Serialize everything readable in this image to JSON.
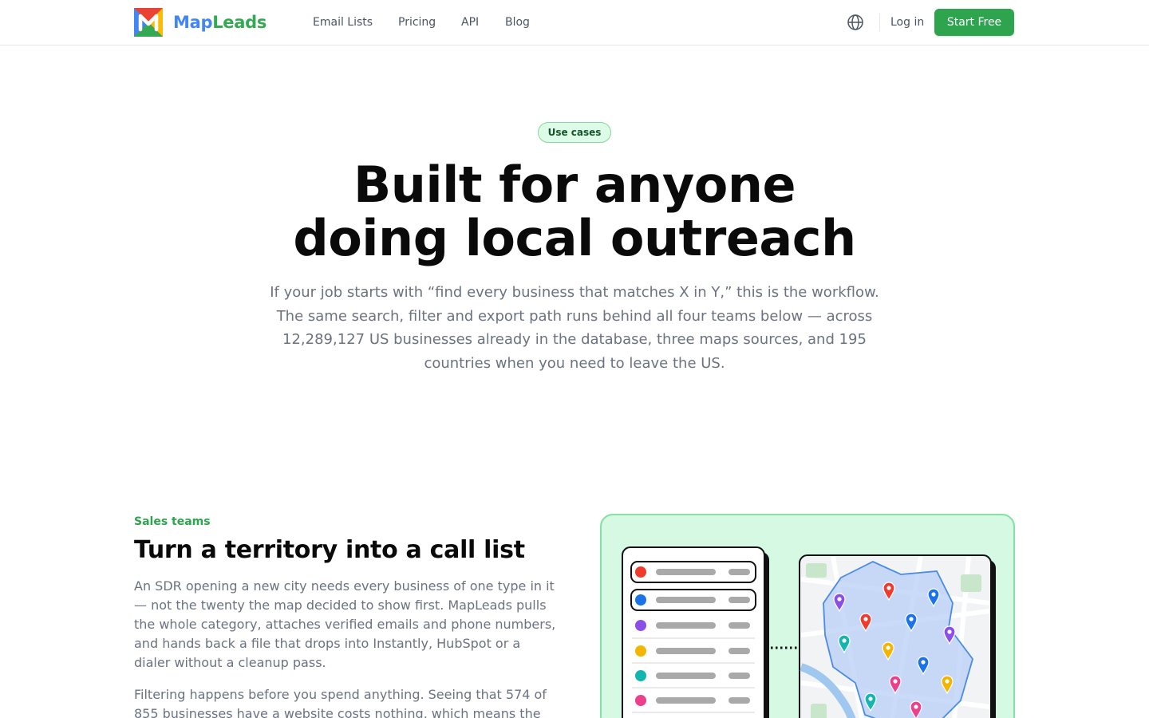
{
  "header": {
    "brand_part1": "Map",
    "brand_part2": "Leads",
    "nav": [
      {
        "label": "Email Lists"
      },
      {
        "label": "Pricing"
      },
      {
        "label": "API"
      },
      {
        "label": "Blog"
      }
    ],
    "language_icon": "globe-icon",
    "login_label": "Log in",
    "cta_label": "Start Free"
  },
  "hero": {
    "badge": "Use cases",
    "title_line1": "Built for anyone",
    "title_line2": "doing local outreach",
    "subtitle_lines": [
      "If your job starts with “find every business that matches X in Y,” this is the workflow.",
      "The same search, filter and export path runs behind all four teams below — across",
      "12,289,127 US businesses already in the database, three maps sources, and 195",
      "countries when you need to leave the US."
    ]
  },
  "section": {
    "label": "Sales teams",
    "title": "Turn a territory into a call list",
    "paragraph1": "An SDR opening a new city needs every business of one type in it — not the twenty the map decided to show first. MapLeads pulls the whole category, attaches verified emails and phone numbers, and hands back a file that drops into Instantly, HubSpot or a dialer without a cleanup pass.",
    "paragraph2": "Filtering happens before you spend anything. Seeing that 574 of 855 businesses have a website costs nothing, which means the"
  },
  "colors": {
    "brand_blue": "#4285f4",
    "brand_green": "#34a853",
    "accent_green": "#2ea44f",
    "illustration_bg": "#d5f9e3",
    "pin_colors": [
      "#ef3b2c",
      "#1a73e8",
      "#8b4fe8",
      "#f5b400",
      "#12b5b0",
      "#ec3f8c"
    ]
  }
}
